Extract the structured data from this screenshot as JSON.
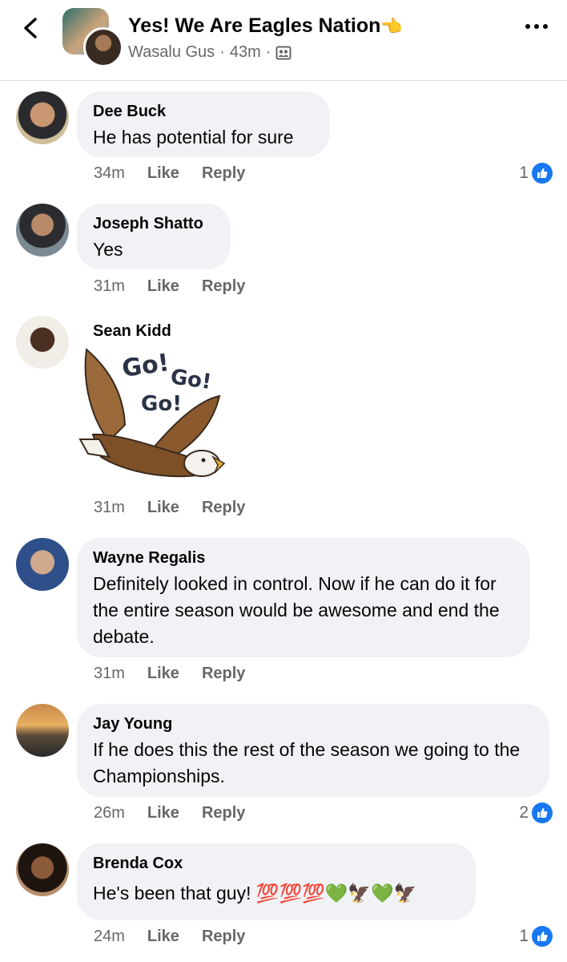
{
  "header": {
    "group_name": "Yes! We Are Eagles Nation",
    "group_emoji": "👈",
    "poster": "Wasalu Gus",
    "time": "43m",
    "separator": "·"
  },
  "actions": {
    "like": "Like",
    "reply": "Reply"
  },
  "comments": [
    {
      "author": "Dee Buck",
      "text": "He has potential for sure",
      "time": "34m",
      "reactions": "1"
    },
    {
      "author": "Joseph Shatto",
      "text": "Yes",
      "time": "31m"
    },
    {
      "author": "Sean Kidd",
      "sticker_text": "Go! Go! Go!",
      "time": "31m"
    },
    {
      "author": "Wayne Regalis",
      "text": "Definitely looked in control. Now if he can do it for the entire season would be awesome and end the debate.",
      "time": "31m"
    },
    {
      "author": "Jay Young",
      "text": "If he does this the rest of the season we going to the Championships.",
      "time": "26m",
      "reactions": "2"
    },
    {
      "author": "Brenda Cox",
      "text": "He's been that guy! 💯💯💯💚🦅💚🦅",
      "time": "24m",
      "reactions": "1"
    }
  ],
  "colors": {
    "accent": "#1877f2",
    "bubble": "#f0f2f5",
    "secondary_text": "#65676b"
  }
}
